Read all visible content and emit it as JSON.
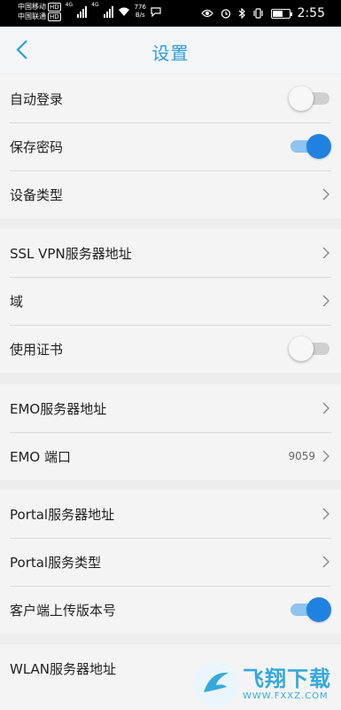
{
  "status_bar": {
    "carrier1": "中国移动",
    "carrier2": "中国联通",
    "hd_badge": "HD",
    "net1": "4G",
    "net2": "4G",
    "speed_value": "776",
    "speed_unit": "B/s",
    "battery_level": 0.6,
    "time": "2:55"
  },
  "header": {
    "title": "设置"
  },
  "groups": [
    {
      "rows": [
        {
          "label": "自动登录",
          "control": "toggle",
          "on": false
        },
        {
          "label": "保存密码",
          "control": "toggle",
          "on": true
        },
        {
          "label": "设备类型",
          "control": "chevron"
        }
      ]
    },
    {
      "rows": [
        {
          "label": "SSL VPN服务器地址",
          "control": "chevron"
        },
        {
          "label": "域",
          "control": "chevron"
        },
        {
          "label": "使用证书",
          "control": "toggle",
          "on": false
        }
      ]
    },
    {
      "rows": [
        {
          "label": "EMO服务器地址",
          "control": "chevron"
        },
        {
          "label": "EMO 端口",
          "value": "9059",
          "control": "chevron"
        }
      ]
    },
    {
      "rows": [
        {
          "label": "Portal服务器地址",
          "control": "chevron"
        },
        {
          "label": "Portal服务类型",
          "control": "chevron"
        },
        {
          "label": "客户端上传版本号",
          "control": "toggle",
          "on": true
        }
      ]
    },
    {
      "rows": [
        {
          "label": "WLAN服务器地址",
          "control": "none"
        }
      ]
    }
  ],
  "watermark": {
    "main": "飞翔下载",
    "sub": "WWW.FXXZ.COM"
  },
  "colors": {
    "accent": "#2f9ed6",
    "toggle_on": "#1f82e0"
  }
}
